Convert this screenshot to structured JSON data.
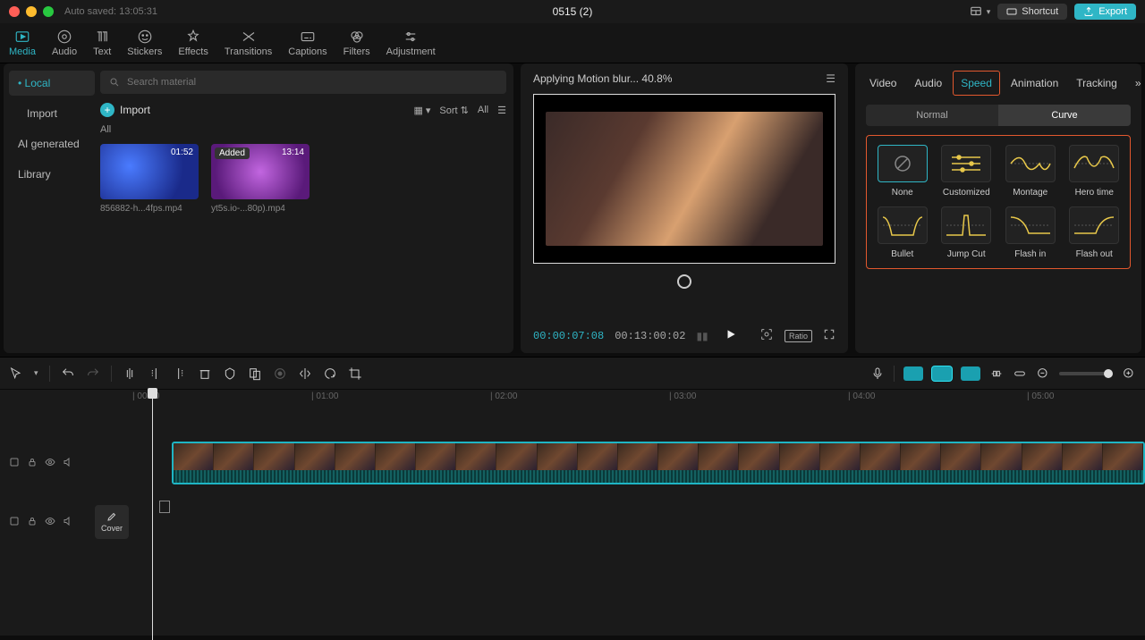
{
  "titlebar": {
    "autosave": "Auto saved: 13:05:31",
    "title": "0515 (2)",
    "shortcut": "Shortcut",
    "export": "Export"
  },
  "tooltabs": [
    {
      "id": "media",
      "label": "Media",
      "active": true
    },
    {
      "id": "audio",
      "label": "Audio"
    },
    {
      "id": "text",
      "label": "Text"
    },
    {
      "id": "stickers",
      "label": "Stickers"
    },
    {
      "id": "effects",
      "label": "Effects"
    },
    {
      "id": "transitions",
      "label": "Transitions"
    },
    {
      "id": "captions",
      "label": "Captions"
    },
    {
      "id": "filters",
      "label": "Filters"
    },
    {
      "id": "adjustment",
      "label": "Adjustment"
    }
  ],
  "media": {
    "side": [
      {
        "label": "Local",
        "active": true,
        "accent": true
      },
      {
        "label": "Import",
        "indent": true
      },
      {
        "label": "AI generated"
      },
      {
        "label": "Library"
      }
    ],
    "search_placeholder": "Search material",
    "import_label": "Import",
    "sort": "Sort",
    "all_chip": "All",
    "section": "All",
    "clips": [
      {
        "name": "856882-h...4fps.mp4",
        "time": "01:52",
        "style": "blue"
      },
      {
        "name": "yt5s.io-...80p).mp4",
        "time": "13:14",
        "style": "purple",
        "added": "Added"
      }
    ]
  },
  "preview": {
    "status": "Applying Motion blur... 40.8%",
    "current": "00:00:07:08",
    "duration": "00:13:00:02",
    "ratio": "Ratio"
  },
  "inspector": {
    "tabs": [
      "Video",
      "Audio",
      "Speed",
      "Animation",
      "Tracking"
    ],
    "active": "Speed",
    "subtabs": [
      "Normal",
      "Curve"
    ],
    "sub_active": "Curve",
    "presets": [
      {
        "id": "none",
        "label": "None",
        "selected": true
      },
      {
        "id": "customized",
        "label": "Customized"
      },
      {
        "id": "montage",
        "label": "Montage"
      },
      {
        "id": "hero",
        "label": "Hero time"
      },
      {
        "id": "bullet",
        "label": "Bullet"
      },
      {
        "id": "jumpcut",
        "label": "Jump Cut"
      },
      {
        "id": "flashin",
        "label": "Flash in"
      },
      {
        "id": "flashout",
        "label": "Flash out"
      }
    ]
  },
  "timeline": {
    "cover": "Cover",
    "ticks": [
      "| 00:00",
      "| 01:00",
      "| 02:00",
      "| 03:00",
      "| 04:00",
      "| 05:00"
    ]
  }
}
